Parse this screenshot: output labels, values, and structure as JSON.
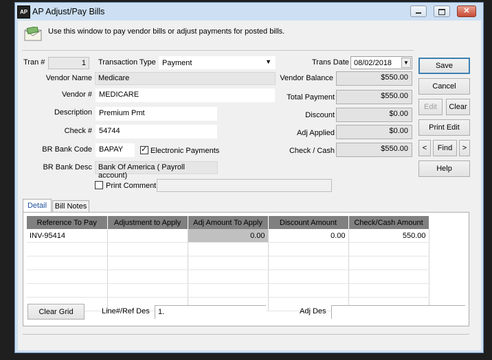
{
  "window": {
    "app_icon": "AP",
    "title": "AP Adjust/Pay Bills",
    "info_text": "Use this window to pay vendor bills or adjust payments for posted bills."
  },
  "form": {
    "tran_label": "Tran #",
    "tran_value": "1",
    "transaction_type_label": "Transaction Type",
    "transaction_type_value": "Payment",
    "trans_date_label": "Trans Date",
    "trans_date_value": "08/02/2018",
    "vendor_name_label": "Vendor Name",
    "vendor_name_value": "Medicare",
    "vendor_no_label": "Vendor #",
    "vendor_no_value": "MEDICARE",
    "description_label": "Description",
    "description_value": "Premium Pmt",
    "check_label": "Check #",
    "check_value": "54744",
    "br_bank_code_label": "BR Bank Code",
    "br_bank_code_value": "BAPAY",
    "electronic_payments_label": "Electronic Payments",
    "br_bank_desc_label": "BR Bank Desc",
    "br_bank_desc_value": "Bank Of America  ( Payroll account)",
    "print_comment_label": "Print Comment",
    "print_comment_value": ""
  },
  "totals": {
    "vendor_balance_label": "Vendor Balance",
    "vendor_balance_value": "$550.00",
    "total_payment_label": "Total Payment",
    "total_payment_value": "$550.00",
    "discount_label": "Discount",
    "discount_value": "$0.00",
    "adj_applied_label": "Adj Applied",
    "adj_applied_value": "$0.00",
    "check_cash_label": "Check / Cash",
    "check_cash_value": "$550.00"
  },
  "buttons": {
    "save": "Save",
    "cancel": "Cancel",
    "edit": "Edit",
    "clear": "Clear",
    "print_edit": "Print Edit",
    "prev": "<",
    "find": "Find",
    "next": ">",
    "help": "Help",
    "clear_grid": "Clear Grid"
  },
  "tabs": {
    "detail": "Detail",
    "bill_notes": "Bill Notes"
  },
  "grid": {
    "columns": [
      "Reference To Pay",
      "Adjustment to Apply",
      "Adj Amount To Apply",
      "Discount Amount",
      "Check/Cash Amount"
    ],
    "rows": [
      [
        "INV-95414",
        "",
        "0.00",
        "0.00",
        "550.00"
      ],
      [
        "",
        "",
        "",
        "",
        ""
      ],
      [
        "",
        "",
        "",
        "",
        ""
      ],
      [
        "",
        "",
        "",
        "",
        ""
      ],
      [
        "",
        "",
        "",
        "",
        ""
      ],
      [
        "",
        "",
        "",
        "",
        ""
      ]
    ]
  },
  "footer": {
    "line_ref_label": "Line#/Ref Des",
    "line_ref_value": "1.",
    "adj_des_label": "Adj Des",
    "adj_des_value": ""
  }
}
